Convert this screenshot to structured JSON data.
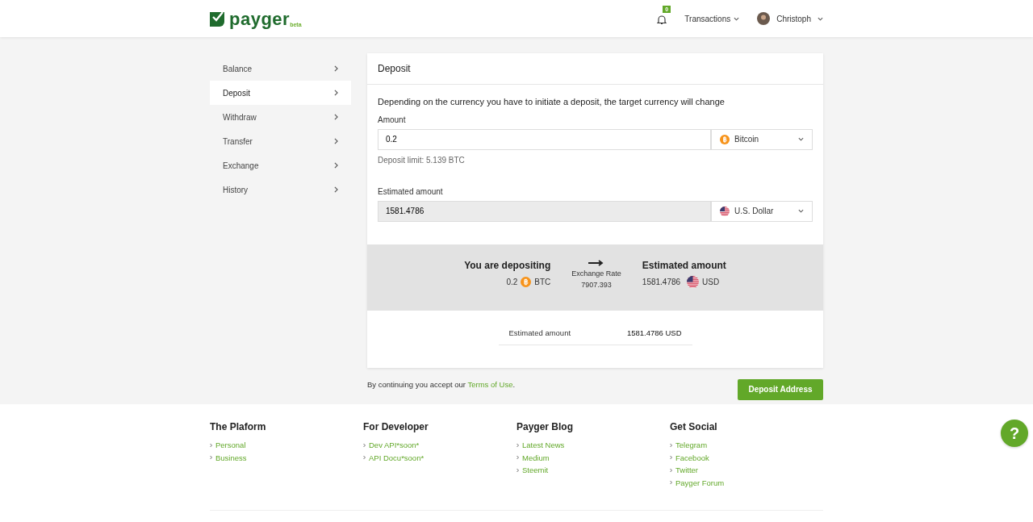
{
  "header": {
    "logo": "payger",
    "logo_tag": "beta",
    "notifications": "0",
    "menu": "Transactions",
    "user": "Christoph"
  },
  "sidebar": {
    "items": [
      {
        "label": "Balance",
        "selected": false
      },
      {
        "label": "Deposit",
        "selected": true
      },
      {
        "label": "Withdraw",
        "selected": false
      },
      {
        "label": "Transfer",
        "selected": false
      },
      {
        "label": "Exchange",
        "selected": false
      },
      {
        "label": "History",
        "selected": false
      }
    ]
  },
  "card": {
    "title": "Deposit",
    "intro": "Depending on the currency you have to initiate a deposit, the target currency will change",
    "amount_label": "Amount",
    "amount": "0.2",
    "amount_currency": {
      "kind": "btc",
      "label": "Bitcoin"
    },
    "limit": "Deposit limit: 5.139 BTC",
    "estimated_label": "Estimated amount",
    "estimated": "1581.4786",
    "estimated_currency": {
      "kind": "usd",
      "label": "U.S. Dollar"
    },
    "summary": {
      "from_title": "You are depositing",
      "from_value": "0.2",
      "from_code": "BTC",
      "rate_label": "Exchange Rate",
      "rate": "7907.393",
      "to_title": "Estimated amount",
      "to_value": "1581.4786",
      "to_code": "USD"
    },
    "total_label": "Estimated amount",
    "total": "1581.4786 USD"
  },
  "terms": {
    "text": "By continuing you accept our ",
    "link": "Terms of Use",
    "end": "."
  },
  "action": "Deposit Address",
  "footer": {
    "columns": [
      {
        "title": "The Plaform",
        "links": [
          "Personal",
          "Business"
        ]
      },
      {
        "title": "For Developer",
        "links": [
          "Dev API*soon*",
          "API Docu*soon*"
        ]
      },
      {
        "title": "Payger Blog",
        "links": [
          "Latest News",
          "Medium",
          "Steemit"
        ]
      },
      {
        "title": "Get Social",
        "links": [
          "Telegram",
          "Facebook",
          "Twitter",
          "Payger Forum"
        ]
      }
    ]
  },
  "help": "?"
}
